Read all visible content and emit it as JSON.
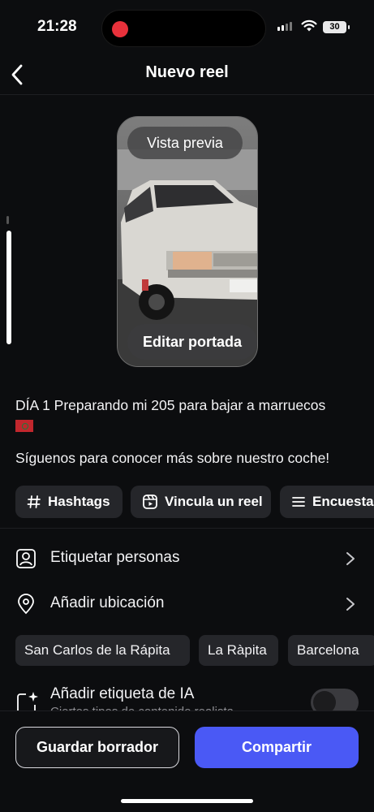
{
  "status_bar": {
    "time": "21:28",
    "battery": "30"
  },
  "nav": {
    "title": "Nuevo reel"
  },
  "cover": {
    "preview_label": "Vista previa",
    "edit_label": "Editar portada"
  },
  "caption": {
    "line1": "DÍA 1 Preparando mi 205 para bajar a marruecos",
    "line2": "Síguenos para conocer más sobre nuestro coche!"
  },
  "chips": [
    {
      "label": "Hashtags",
      "icon": "hash-icon"
    },
    {
      "label": "Vincula un reel",
      "icon": "reel-icon"
    },
    {
      "label": "Encuesta",
      "icon": "list-icon"
    }
  ],
  "rows": {
    "tag_people": {
      "label": "Etiquetar personas",
      "icon": "person-tag-icon"
    },
    "add_location": {
      "label": "Añadir ubicación",
      "icon": "location-pin-icon"
    }
  },
  "location_suggestions": [
    "San Carlos de la Rápita",
    "La Ràpita",
    "Barcelona"
  ],
  "ai_label": {
    "label": "Añadir etiqueta de IA",
    "sublabel": "Ciertos tipos de contenido realista",
    "enabled": false
  },
  "actions": {
    "save_draft": "Guardar borrador",
    "share": "Compartir"
  },
  "colors": {
    "accent": "#4a59f5",
    "background": "#0c0d0f",
    "chip": "#25262a"
  }
}
